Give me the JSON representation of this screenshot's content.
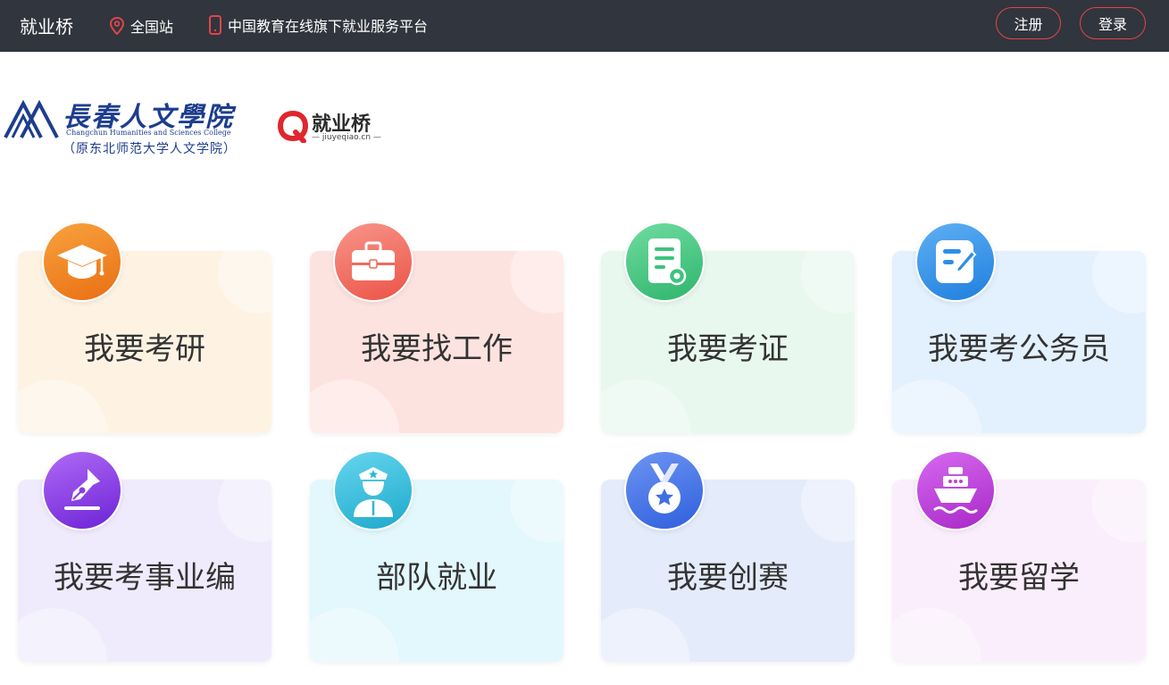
{
  "topbar": {
    "brand": "就业桥",
    "location": "全国站",
    "slogan": "中国教育在线旗下就业服务平台",
    "register_label": "注册",
    "login_label": "登录",
    "accent_color": "#e0464b",
    "bg_color": "#31353d"
  },
  "logos": {
    "college_name": "長春人文學院",
    "college_en": "Changchun Humanities and Sciences College",
    "college_sub": "（原东北师范大学人文学院）",
    "jyq_name": "就业桥",
    "jyq_url": "— jiuyeqiao.cn —"
  },
  "cards": [
    {
      "label": "我要考研",
      "icon": "graduation-cap-icon",
      "bg": "#fef3e3",
      "icon_color": "#ef8a1f"
    },
    {
      "label": "我要找工作",
      "icon": "briefcase-icon",
      "bg": "#fde3e0",
      "icon_color": "#ef5e52"
    },
    {
      "label": "我要考证",
      "icon": "certificate-icon",
      "bg": "#e8f8ef",
      "icon_color": "#3cc47c"
    },
    {
      "label": "我要考公务员",
      "icon": "form-edit-icon",
      "bg": "#e3f0fd",
      "icon_color": "#2c8fe6"
    },
    {
      "label": "我要考事业编",
      "icon": "pen-nib-icon",
      "bg": "#efebfc",
      "icon_color": "#8a3de0"
    },
    {
      "label": "部队就业",
      "icon": "soldier-icon",
      "bg": "#e3f8fc",
      "icon_color": "#2bb9d6"
    },
    {
      "label": "我要创赛",
      "icon": "medal-icon",
      "bg": "#e4ebfa",
      "icon_color": "#3f6fe2"
    },
    {
      "label": "我要留学",
      "icon": "ship-icon",
      "bg": "#fbeefc",
      "icon_color": "#c43fd6"
    }
  ]
}
